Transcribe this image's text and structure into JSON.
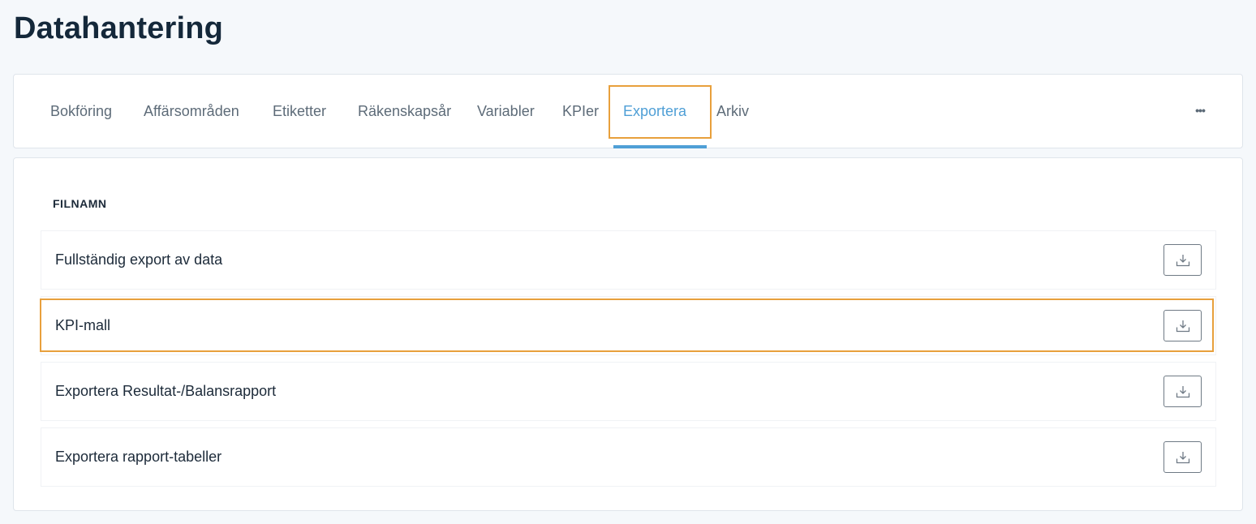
{
  "page": {
    "title": "Datahantering"
  },
  "tabs": {
    "items": [
      {
        "label": "Bokföring"
      },
      {
        "label": "Affärsområden"
      },
      {
        "label": "Etiketter"
      },
      {
        "label": "Räkenskapsår"
      },
      {
        "label": "Variabler"
      },
      {
        "label": "KPIer"
      },
      {
        "label": "Exportera",
        "active": true
      },
      {
        "label": "Arkiv"
      }
    ],
    "more_label": "•••"
  },
  "exports": {
    "column_header": "FILNAMN",
    "rows": [
      {
        "name": "Fullständig export av data",
        "icon": "download-icon"
      },
      {
        "name": "KPI-mall",
        "icon": "download-icon"
      },
      {
        "name": "Exportera Resultat-/Balansrapport",
        "icon": "download-icon"
      },
      {
        "name": "Exportera rapport-tabeller",
        "icon": "download-icon"
      }
    ]
  },
  "colors": {
    "accent": "#4f9fd6",
    "highlight": "#e8a03c",
    "text": "#1c2a39",
    "muted": "#5d6b78"
  }
}
